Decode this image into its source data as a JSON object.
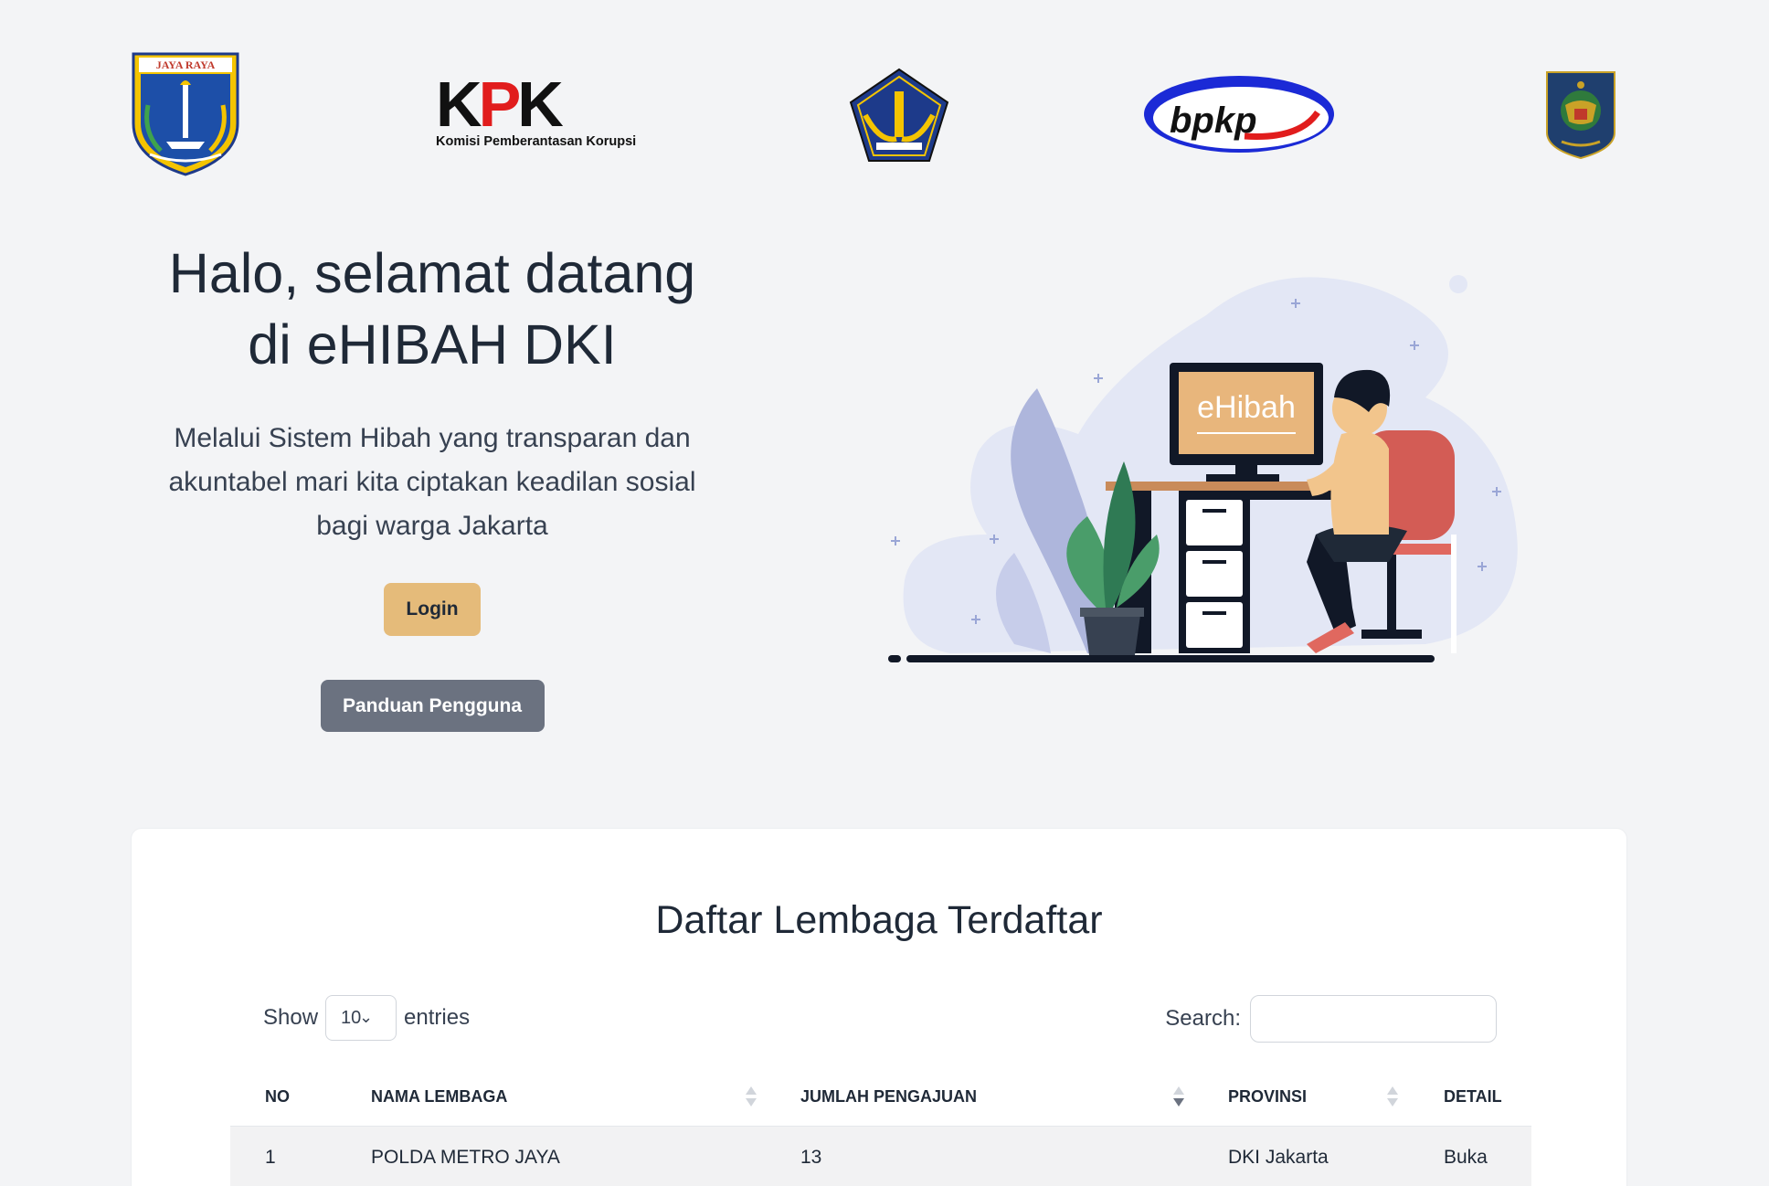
{
  "logos": {
    "dki": {
      "name": "Pemprov DKI Jakarta",
      "motto": "JAYA RAYA"
    },
    "kpk": {
      "letters": "KPK",
      "subtitle": "Komisi Pemberantasan Korupsi"
    },
    "kemenkeu": {
      "name": "Kementerian Keuangan"
    },
    "bpkp": {
      "text": "bpkp"
    },
    "kemendagri": {
      "name": "Kementerian Dalam Negeri"
    }
  },
  "hero": {
    "title_line1": "Halo, selamat datang",
    "title_line2": "di eHIBAH DKI",
    "description": "Melalui Sistem Hibah yang transparan dan akuntabel mari kita ciptakan keadilan sosial bagi warga Jakarta",
    "login_label": "Login",
    "guide_label": "Panduan Pengguna",
    "illustration_screen_text": "eHibah"
  },
  "registry": {
    "title": "Daftar Lembaga Terdaftar",
    "show_label": "Show",
    "entries_value": "10",
    "entries_label": "entries",
    "search_label": "Search:",
    "search_value": "",
    "columns": [
      "NO",
      "NAMA LEMBAGA",
      "JUMLAH PENGAJUAN",
      "PROVINSI",
      "DETAIL"
    ],
    "rows": [
      {
        "no": "1",
        "nama": "POLDA METRO JAYA",
        "jumlah": "13",
        "provinsi": "DKI Jakarta",
        "detail": "Buka"
      }
    ]
  },
  "colors": {
    "background": "#f3f4f6",
    "login_button": "#e5bb7a",
    "guide_button": "#6b7280",
    "kpk_red": "#e11d1d",
    "bpkp_blue": "#1b2ad6"
  }
}
